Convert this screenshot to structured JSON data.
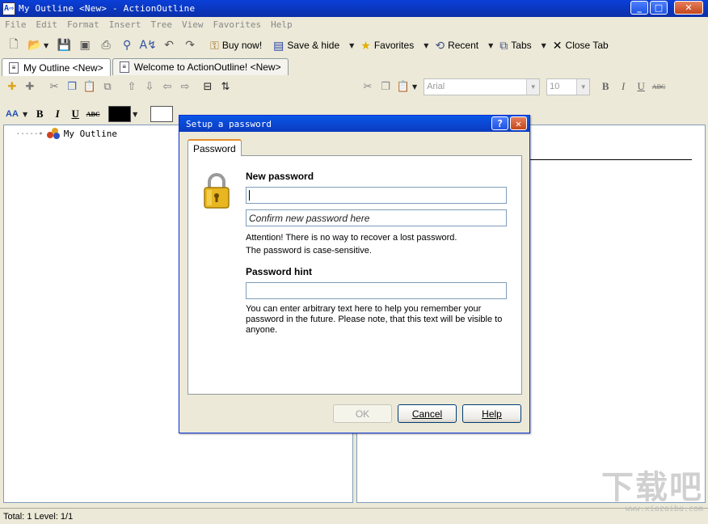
{
  "window": {
    "title": "My Outline <New> - ActionOutline",
    "app_icon": "A⇨",
    "controls": [
      "minimize",
      "maximize",
      "close"
    ]
  },
  "menu": [
    "File",
    "Edit",
    "Format",
    "Insert",
    "Tree",
    "View",
    "Favorites",
    "Help"
  ],
  "toolbar": {
    "buy_label": "Buy now!",
    "save_hide_label": "Save & hide",
    "favorites_label": "Favorites",
    "recent_label": "Recent",
    "tabs_label": "Tabs",
    "close_tab_label": "Close Tab"
  },
  "doc_tabs": [
    {
      "label": "My Outline <New>",
      "active": true
    },
    {
      "label": "Welcome to ActionOutline! <New>",
      "active": false
    }
  ],
  "format_bar": {
    "aa_label": "AA",
    "bold": "B",
    "italic": "I",
    "underline": "U",
    "strike": "ABC"
  },
  "editor_toolbar": {
    "font_value": "Arial",
    "size_value": "10"
  },
  "tree": {
    "root_label": "My Outline"
  },
  "dialog": {
    "title": "Setup a password",
    "tab_label": "Password",
    "new_password_label": "New password",
    "new_password_value": "",
    "confirm_placeholder": "Confirm new password here",
    "warning_line1": "Attention! There is no way to recover a lost password.",
    "warning_line2": "The password is case-sensitive.",
    "hint_label": "Password hint",
    "hint_value": "",
    "hint_help": "You can enter arbitrary text here to help you remember your password in the future. Please note, that this text will be visible to anyone.",
    "ok_label": "OK",
    "cancel_label": "Cancel",
    "help_label": "Help"
  },
  "status": {
    "text": "Total: 1 Level: 1/1"
  },
  "watermark": {
    "text": "下载吧",
    "url": "www.xiazaiba.com"
  }
}
